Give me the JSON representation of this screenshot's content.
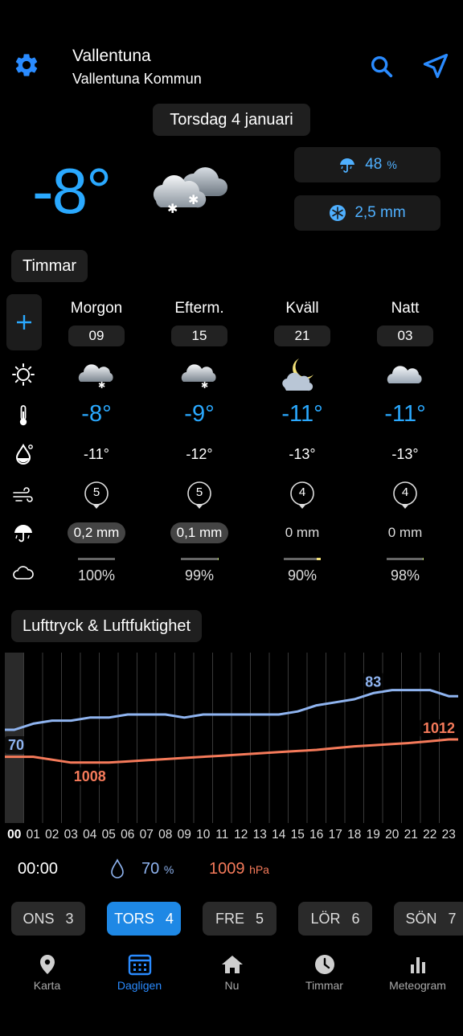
{
  "header": {
    "location_name": "Vallentuna",
    "municipality": "Vallentuna Kommun"
  },
  "date_label": "Torsdag 4 januari",
  "current": {
    "temperature": "-8°",
    "precip_probability": "48",
    "precip_probability_unit": "%",
    "precip_amount": "2,5 mm"
  },
  "sections": {
    "hours": "Timmar",
    "pressure_humidity": "Lufttryck & Luftfuktighet"
  },
  "periods": [
    {
      "name": "Morgon",
      "hour": "09",
      "icon": "cloud-snow-icon",
      "temp": "-8°",
      "feels": "-11°",
      "wind": "5",
      "rain": "0,2 mm",
      "rain_highlight": true,
      "cloud_pct": "100%",
      "cloud_frac": 1.0
    },
    {
      "name": "Efterm.",
      "hour": "15",
      "icon": "cloud-snow-icon",
      "temp": "-9°",
      "feels": "-12°",
      "wind": "5",
      "rain": "0,1 mm",
      "rain_highlight": true,
      "cloud_pct": "99%",
      "cloud_frac": 0.99
    },
    {
      "name": "Kväll",
      "hour": "21",
      "icon": "moon-cloud-icon",
      "temp": "-11°",
      "feels": "-13°",
      "wind": "4",
      "rain": "0 mm",
      "rain_highlight": false,
      "cloud_pct": "90%",
      "cloud_frac": 0.9
    },
    {
      "name": "Natt",
      "hour": "03",
      "icon": "cloud-icon",
      "temp": "-11°",
      "feels": "-13°",
      "wind": "4",
      "rain": "0 mm",
      "rain_highlight": false,
      "cloud_pct": "98%",
      "cloud_frac": 0.98
    }
  ],
  "chart_data": {
    "type": "line",
    "x": [
      "00",
      "01",
      "02",
      "03",
      "04",
      "05",
      "06",
      "07",
      "08",
      "09",
      "10",
      "11",
      "12",
      "13",
      "14",
      "15",
      "16",
      "17",
      "18",
      "19",
      "20",
      "21",
      "22",
      "23"
    ],
    "series": [
      {
        "name": "Luftfuktighet",
        "unit": "%",
        "color": "#8fb4f0",
        "values": [
          70,
          72,
          73,
          73,
          74,
          74,
          75,
          75,
          75,
          74,
          75,
          75,
          75,
          75,
          75,
          76,
          78,
          79,
          80,
          82,
          83,
          83,
          83,
          81
        ],
        "labels": [
          {
            "index": 0,
            "text": "70"
          },
          {
            "index": 19,
            "text": "83"
          }
        ]
      },
      {
        "name": "Lufttryck",
        "unit": "hPa",
        "color": "#f57a5a",
        "values": [
          1009,
          1009,
          1008.5,
          1008,
          1008,
          1008,
          1008.2,
          1008.4,
          1008.6,
          1008.8,
          1009,
          1009.2,
          1009.4,
          1009.6,
          1009.8,
          1010,
          1010.2,
          1010.5,
          1010.8,
          1011,
          1011.2,
          1011.4,
          1011.7,
          1012
        ],
        "labels": [
          {
            "index": 4,
            "text": "1008"
          },
          {
            "index": 23,
            "text": "1012"
          }
        ]
      }
    ],
    "selected_hour": "00"
  },
  "readout": {
    "time": "00:00",
    "humidity": "70",
    "humidity_unit": "%",
    "pressure": "1009",
    "pressure_unit": "hPa"
  },
  "days": [
    {
      "name": "ONS",
      "num": "3",
      "active": false
    },
    {
      "name": "TORS",
      "num": "4",
      "active": true
    },
    {
      "name": "FRE",
      "num": "5",
      "active": false
    },
    {
      "name": "LÖR",
      "num": "6",
      "active": false
    },
    {
      "name": "SÖN",
      "num": "7",
      "active": false
    }
  ],
  "tabs": [
    {
      "label": "Karta",
      "icon": "map-pin-icon",
      "active": false
    },
    {
      "label": "Dagligen",
      "icon": "calendar-icon",
      "active": true
    },
    {
      "label": "Nu",
      "icon": "home-icon",
      "active": false
    },
    {
      "label": "Timmar",
      "icon": "clock-icon",
      "active": false
    },
    {
      "label": "Meteogram",
      "icon": "bar-chart-icon",
      "active": false
    }
  ],
  "colors": {
    "accent": "#2aa9ff",
    "humidity": "#8fb4f0",
    "pressure": "#f57a5a",
    "tab_active": "#2a8bff"
  }
}
